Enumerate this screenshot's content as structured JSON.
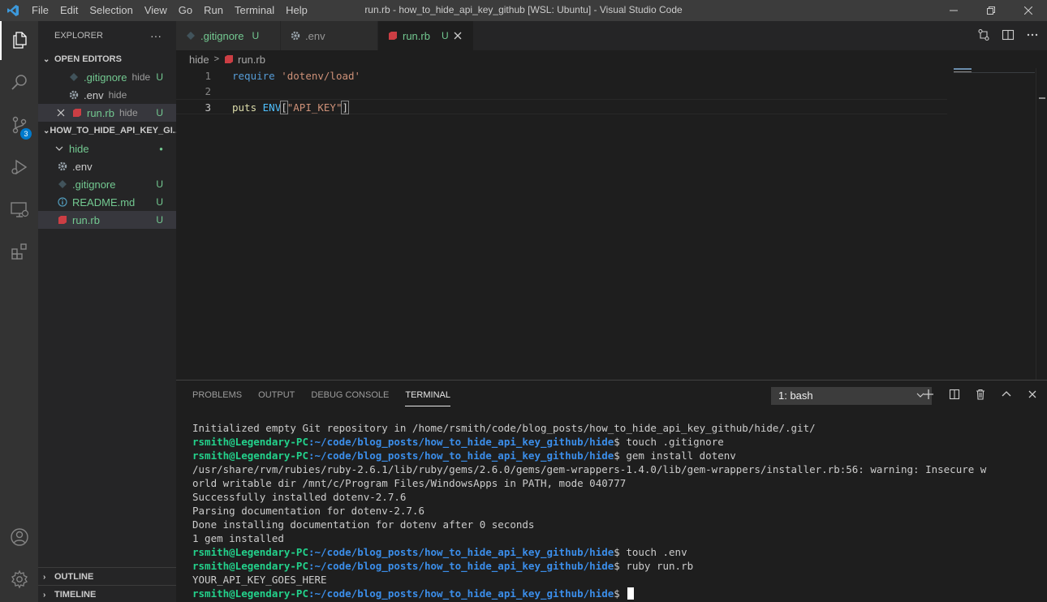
{
  "titlebar": {
    "menu": [
      "File",
      "Edit",
      "Selection",
      "View",
      "Go",
      "Run",
      "Terminal",
      "Help"
    ],
    "title": "run.rb - how_to_hide_api_key_github [WSL: Ubuntu] - Visual Studio Code"
  },
  "activity": {
    "scm_badge": "3"
  },
  "explorer": {
    "title": "EXPLORER",
    "more": "···",
    "open_editors_label": "OPEN EDITORS",
    "open_editors": [
      {
        "name": ".gitignore",
        "desc": "hide",
        "status": "U"
      },
      {
        "name": ".env",
        "desc": "hide",
        "status": ""
      },
      {
        "name": "run.rb",
        "desc": "hide",
        "status": "U"
      }
    ],
    "project_label": "HOW_TO_HIDE_API_KEY_GI...",
    "folder": "hide",
    "folder_dot": "●",
    "files": [
      {
        "name": ".env",
        "status": ""
      },
      {
        "name": ".gitignore",
        "status": "U"
      },
      {
        "name": "README.md",
        "status": "U"
      },
      {
        "name": "run.rb",
        "status": "U"
      }
    ],
    "outline_label": "OUTLINE",
    "timeline_label": "TIMELINE"
  },
  "tabs": [
    {
      "name": ".gitignore",
      "status": "U"
    },
    {
      "name": ".env",
      "status": ""
    },
    {
      "name": "run.rb",
      "status": "U"
    }
  ],
  "breadcrumb": {
    "folder": "hide",
    "file": "run.rb"
  },
  "editor": {
    "line_numbers": [
      "1",
      "2",
      "3"
    ],
    "line1": {
      "kw": "require",
      "str": "'dotenv/load'"
    },
    "line3": {
      "id": "puts",
      "const": "ENV",
      "open": "[",
      "str": "\"API_KEY\"",
      "close": "]"
    }
  },
  "panel": {
    "tabs": [
      "PROBLEMS",
      "OUTPUT",
      "DEBUG CONSOLE",
      "TERMINAL"
    ],
    "terminal_select": "1: bash"
  },
  "terminal": {
    "user": "rsmith@Legendary-PC",
    "path": ":~/code/blog_posts/how_to_hide_api_key_github/hide",
    "prompt_char": "$",
    "lines": [
      {
        "type": "out",
        "text": "Initialized empty Git repository in /home/rsmith/code/blog_posts/how_to_hide_api_key_github/hide/.git/"
      },
      {
        "type": "cmd",
        "text": " touch .gitignore"
      },
      {
        "type": "cmd",
        "text": " gem install dotenv"
      },
      {
        "type": "out",
        "text": "/usr/share/rvm/rubies/ruby-2.6.1/lib/ruby/gems/2.6.0/gems/gem-wrappers-1.4.0/lib/gem-wrappers/installer.rb:56: warning: Insecure w"
      },
      {
        "type": "out",
        "text": "orld writable dir /mnt/c/Program Files/WindowsApps in PATH, mode 040777"
      },
      {
        "type": "out",
        "text": "Successfully installed dotenv-2.7.6"
      },
      {
        "type": "out",
        "text": "Parsing documentation for dotenv-2.7.6"
      },
      {
        "type": "out",
        "text": "Done installing documentation for dotenv after 0 seconds"
      },
      {
        "type": "out",
        "text": "1 gem installed"
      },
      {
        "type": "cmd",
        "text": " touch .env"
      },
      {
        "type": "cmd",
        "text": " ruby run.rb"
      },
      {
        "type": "out",
        "text": "YOUR_API_KEY_GOES_HERE"
      },
      {
        "type": "cmd",
        "text": " "
      }
    ]
  }
}
